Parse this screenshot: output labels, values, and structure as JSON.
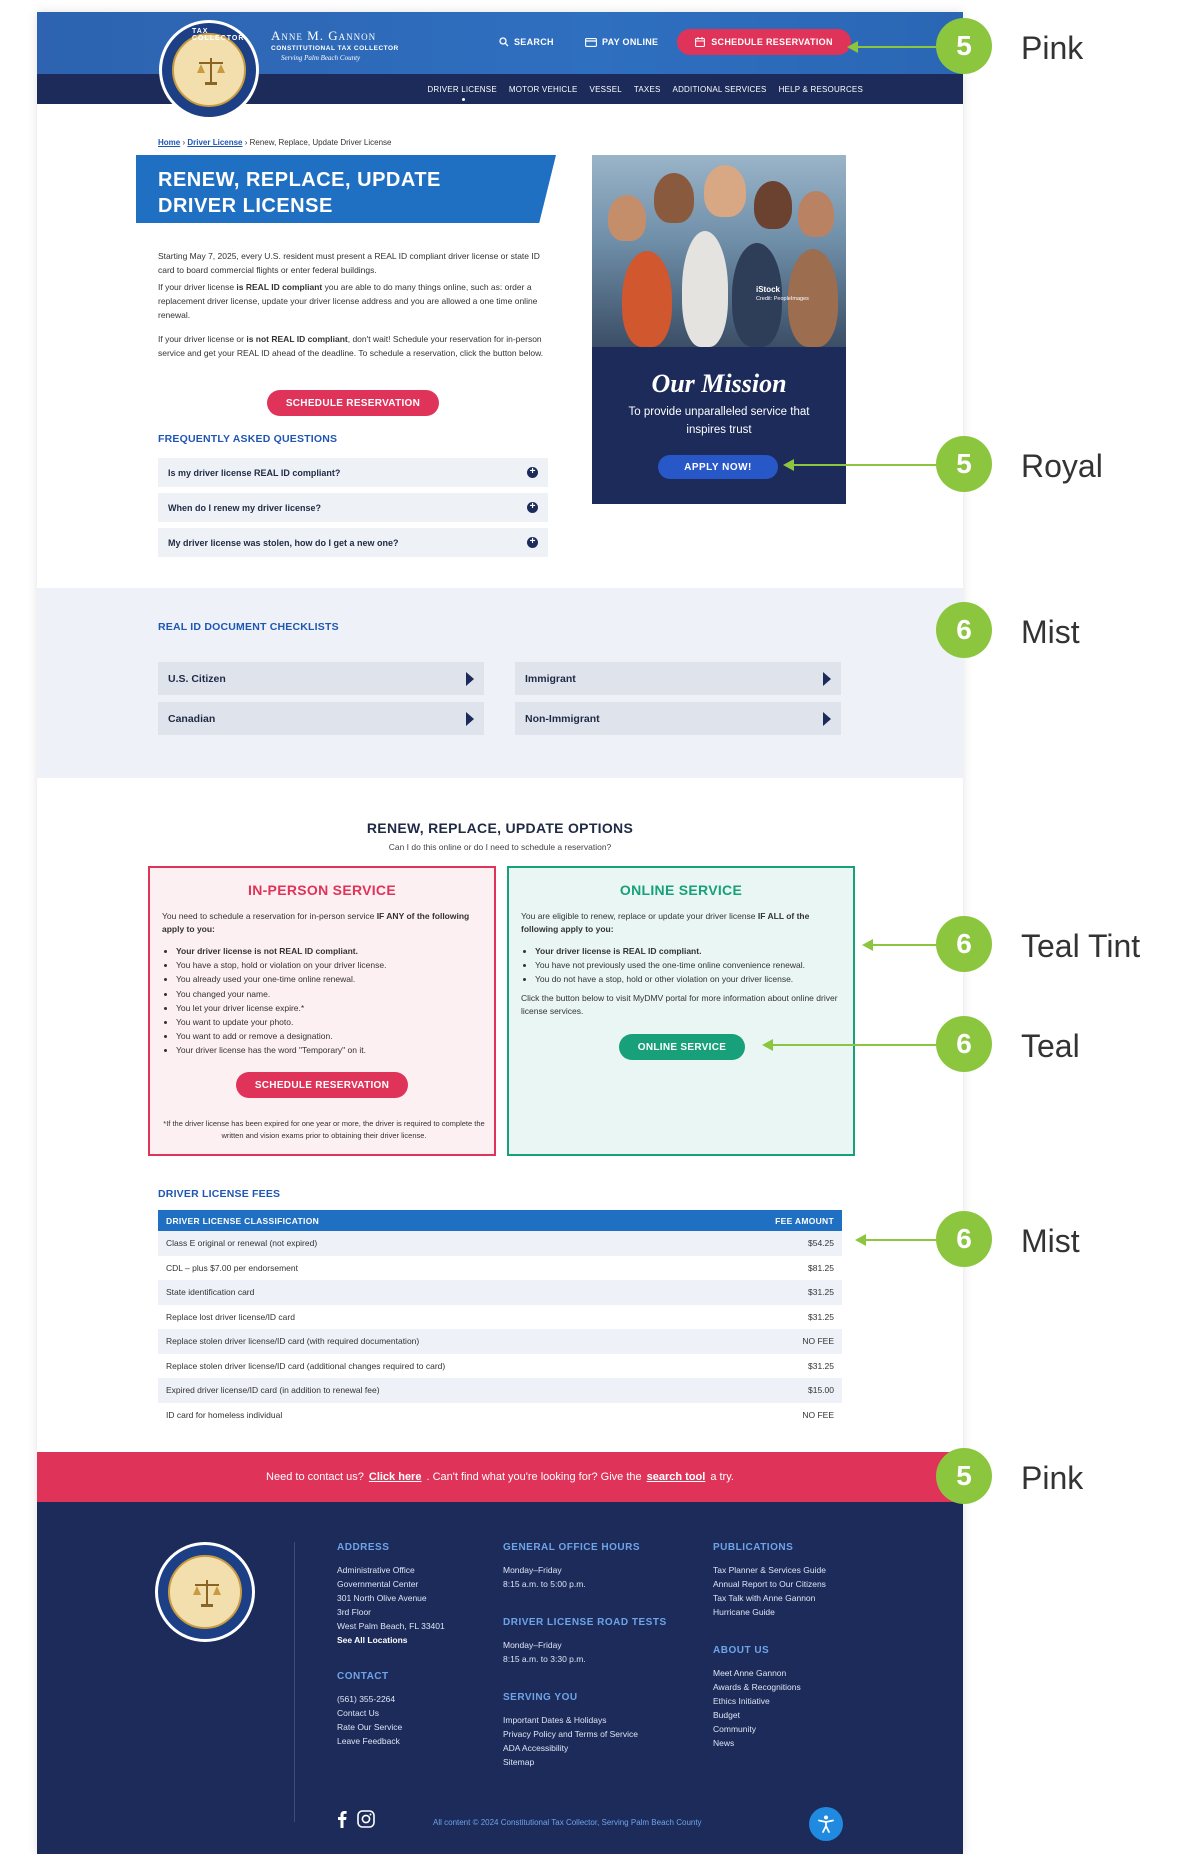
{
  "header": {
    "name": "Anne M. Gannon",
    "subtitle": "CONSTITUTIONAL TAX COLLECTOR",
    "tagline": "Serving Palm Beach County",
    "seal_text": "TAX COLLECTOR",
    "search": "SEARCH",
    "pay": "PAY ONLINE",
    "schedule": "SCHEDULE RESERVATION",
    "nav": [
      "DRIVER LICENSE",
      "MOTOR VEHICLE",
      "VESSEL",
      "TAXES",
      "ADDITIONAL SERVICES",
      "HELP & RESOURCES"
    ]
  },
  "breadcrumb": {
    "home": "Home",
    "driver": "Driver License",
    "current": "Renew, Replace, Update Driver License"
  },
  "title": {
    "line1": "RENEW, REPLACE, UPDATE",
    "line2": "DRIVER LICENSE"
  },
  "intro": {
    "p1": "Starting May 7, 2025, every U.S. resident must present a REAL ID compliant driver license or state ID card to board commercial flights or enter federal buildings.",
    "p2a": "If your driver license ",
    "p2b": "is REAL ID compliant",
    "p2c": " you are able to do many things online, such as: order a replacement driver license, update your driver license address and you are allowed a one time online renewal.",
    "p3a": "If your driver license or ",
    "p3b": "is not REAL ID compliant",
    "p3c": ", don't wait! Schedule your reservation for in-person service and get your REAL ID ahead of the deadline. To schedule a reservation, click the button below.",
    "button": "SCHEDULE RESERVATION"
  },
  "faq": {
    "title": "FREQUENTLY ASKED QUESTIONS",
    "items": [
      "Is my driver license REAL ID compliant?",
      "When do I renew my driver license?",
      "My driver license was stolen, how do I get a new one?"
    ]
  },
  "mission": {
    "stock": "iStock",
    "credit": "Credit: PeopleImages",
    "title": "Our Mission",
    "text": "To provide unparalleled service that inspires trust",
    "button": "APPLY NOW!"
  },
  "checklists": {
    "title": "REAL ID DOCUMENT CHECKLISTS",
    "items": [
      "U.S. Citizen",
      "Immigrant",
      "Canadian",
      "Non-Immigrant"
    ]
  },
  "options": {
    "title": "RENEW, REPLACE, UPDATE OPTIONS",
    "subtitle": "Can I do this online or do I need to schedule a reservation?",
    "in_person": {
      "title": "IN-PERSON SERVICE",
      "intro_a": "You need to schedule a reservation for in-person service ",
      "intro_b": "IF ANY of the following apply to you:",
      "list": [
        "Your driver license is not REAL ID compliant.",
        "You have a stop, hold or violation on your driver license.",
        "You already used your one-time online renewal.",
        "You changed your name.",
        "You let your driver license expire.*",
        "You want to update your photo.",
        "You want to add or remove a designation.",
        "Your driver license has the word \"Temporary\" on it."
      ],
      "button": "SCHEDULE RESERVATION",
      "note": "*If the driver license has been expired for one year or more, the driver is required to complete the written and vision exams prior to obtaining their driver license."
    },
    "online": {
      "title": "ONLINE SERVICE",
      "intro_a": "You are eligible to renew, replace or update your driver license ",
      "intro_b": "IF ALL of the following apply to you:",
      "list": [
        "Your driver license is REAL ID compliant.",
        "You have not previously used the one-time online convenience renewal.",
        "You do not have a stop, hold or other violation on your driver license."
      ],
      "text": "Click the button below to visit MyDMV portal for more information about online driver license services.",
      "button": "ONLINE SERVICE"
    }
  },
  "fees": {
    "title": "DRIVER LICENSE FEES",
    "col1": "DRIVER LICENSE CLASSIFICATION",
    "col2": "FEE AMOUNT",
    "rows": [
      [
        "Class E original or renewal (not expired)",
        "$54.25"
      ],
      [
        "CDL – plus $7.00 per endorsement",
        "$81.25"
      ],
      [
        "State identification card",
        "$31.25"
      ],
      [
        "Replace lost driver license/ID card",
        "$31.25"
      ],
      [
        "Replace stolen driver license/ID card (with required documentation)",
        "NO FEE"
      ],
      [
        "Replace stolen driver license/ID card (additional changes required to card)",
        "$31.25"
      ],
      [
        "Expired driver license/ID card (in addition to renewal fee)",
        "$15.00"
      ],
      [
        "ID card for homeless individual",
        "NO FEE"
      ]
    ]
  },
  "contact_bar": {
    "a": "Need to contact us?",
    "b": "Click here",
    "c": ". Can't find what you're looking for? Give the",
    "d": "search tool",
    "e": "a try."
  },
  "footer": {
    "address_h": "ADDRESS",
    "address": [
      "Administrative Office",
      "Governmental Center",
      "301 North Olive Avenue",
      "3rd Floor",
      "West Palm Beach, FL 33401"
    ],
    "locations": "See All Locations",
    "contact_h": "CONTACT",
    "contact": [
      "(561) 355-2264",
      "Contact Us",
      "Rate Our Service",
      "Leave Feedback"
    ],
    "hours_h": "GENERAL OFFICE HOURS",
    "hours": [
      "Monday–Friday",
      "8:15 a.m. to 5:00 p.m."
    ],
    "road_h": "DRIVER LICENSE ROAD TESTS",
    "road": [
      "Monday–Friday",
      "8:15 a.m. to 3:30 p.m."
    ],
    "serving_h": "SERVING YOU",
    "serving": [
      "Important Dates & Holidays",
      "Privacy Policy and Terms of Service",
      "ADA Accessibility",
      "Sitemap"
    ],
    "pubs_h": "PUBLICATIONS",
    "pubs": [
      "Tax Planner & Services Guide",
      "Annual Report to Our Citizens",
      "Tax Talk with Anne Gannon",
      "Hurricane Guide"
    ],
    "about_h": "ABOUT US",
    "about": [
      "Meet Anne Gannon",
      "Awards & Recognitions",
      "Ethics Initiative",
      "Budget",
      "Community",
      "News"
    ],
    "copyright": "All content © 2024 Constitutional Tax Collector, Serving Palm Beach County"
  },
  "annotations": [
    {
      "num": "5",
      "label": "Pink"
    },
    {
      "num": "5",
      "label": "Royal"
    },
    {
      "num": "6",
      "label": "Mist"
    },
    {
      "num": "6",
      "label": "Teal Tint"
    },
    {
      "num": "6",
      "label": "Teal"
    },
    {
      "num": "6",
      "label": "Mist"
    },
    {
      "num": "5",
      "label": "Pink"
    }
  ],
  "colors": {
    "pink": "#e0335a",
    "royal": "#2857c8",
    "mist": "#eef1f7",
    "teal": "#17a07a",
    "teal_tint": "#eaf6f3",
    "navy": "#1c2b5a",
    "annotation_green": "#8cc63f"
  }
}
